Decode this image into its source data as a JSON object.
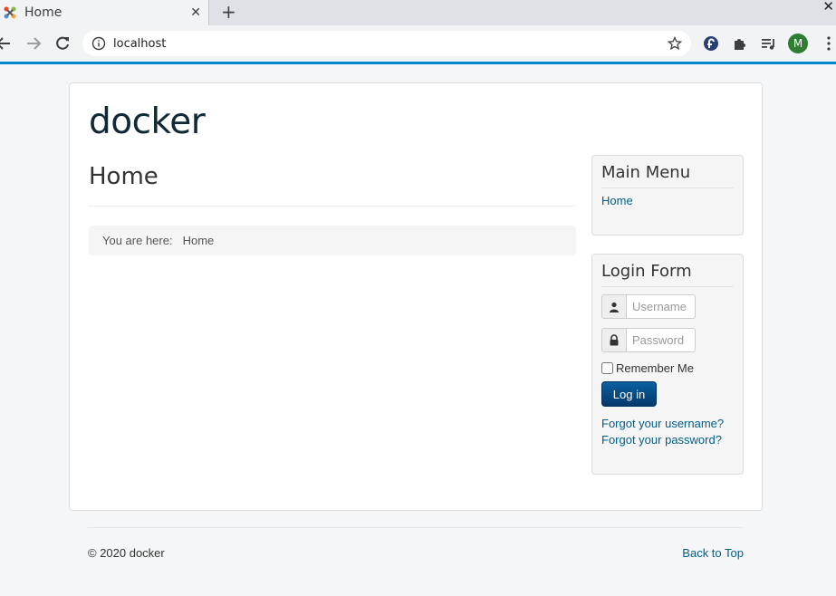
{
  "browser": {
    "tab_title": "Home",
    "tab_close": "✕",
    "new_tab": "+",
    "window_close": "✕",
    "url": "localhost",
    "profile_initial": "M",
    "accent_color": "#0088cc"
  },
  "site": {
    "title": "docker"
  },
  "page": {
    "heading": "Home",
    "breadcrumb_label": "You are here:",
    "breadcrumb_items": [
      "Home"
    ]
  },
  "main_menu": {
    "title": "Main Menu",
    "items": [
      {
        "label": "Home"
      }
    ]
  },
  "login_form": {
    "title": "Login Form",
    "username_placeholder": "Username",
    "password_placeholder": "Password",
    "remember_label": "Remember Me",
    "remember_checked": false,
    "login_button": "Log in",
    "forgot_username": "Forgot your username?",
    "forgot_password": "Forgot your password?"
  },
  "footer": {
    "copyright": "© 2020 docker",
    "back_to_top": "Back to Top"
  }
}
